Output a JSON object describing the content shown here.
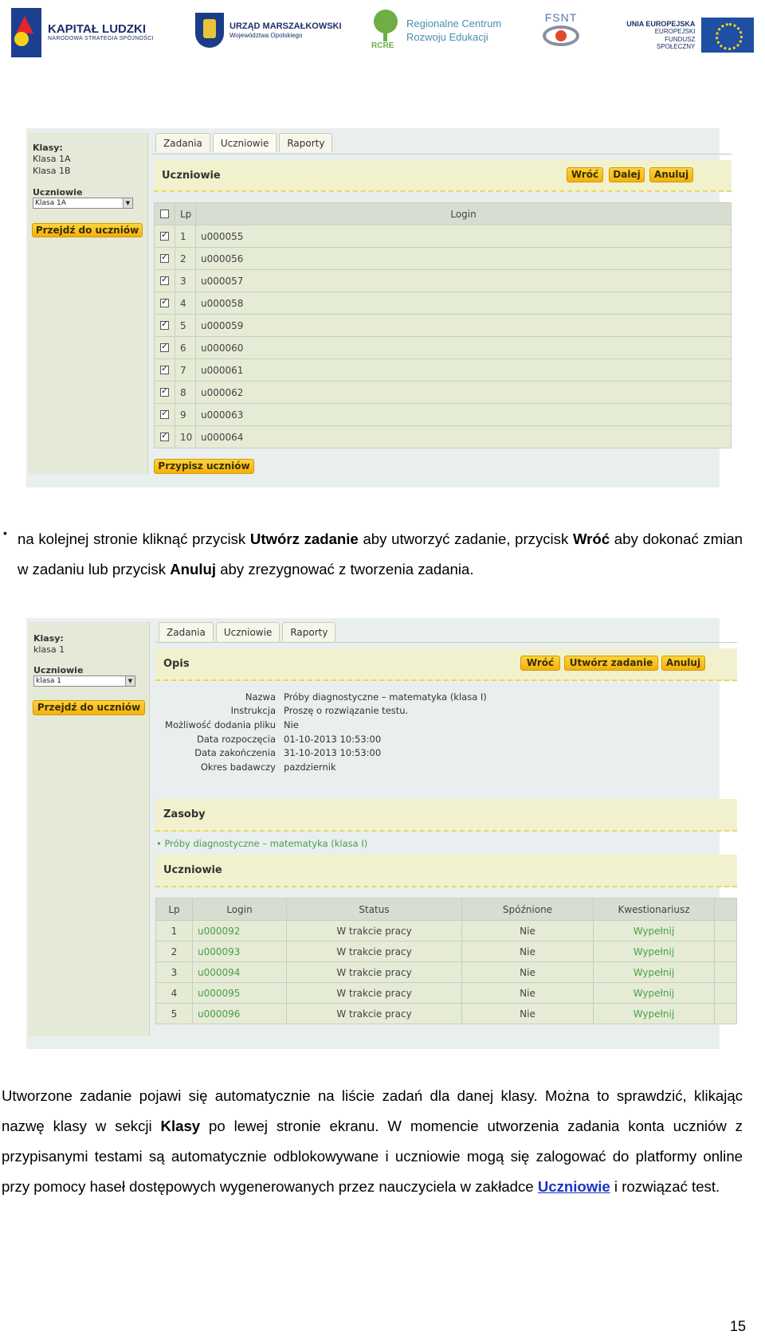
{
  "header": {
    "kapital_ludzki": {
      "title": "KAPITAŁ LUDZKI",
      "subtitle": "NARODOWA STRATEGIA SPÓJNOŚCI"
    },
    "urzad": {
      "title": "URZĄD MARSZAŁKOWSKI",
      "subtitle": "Województwa Opolskiego"
    },
    "rcre": {
      "abbr": "RCRE",
      "line1": "Regionalne Centrum",
      "line2": "Rozwoju Edukacji"
    },
    "fsnt": {
      "abbr": "FSNT"
    },
    "ue": {
      "line1": "UNIA EUROPEJSKA",
      "line2": "EUROPEJSKI",
      "line3": "FUNDUSZ SPOŁECZNY"
    }
  },
  "screen1": {
    "sidebar": {
      "classes_heading": "Klasy:",
      "classes": [
        "Klasa 1A",
        "Klasa 1B"
      ],
      "students_heading": "Uczniowie",
      "select_value": "Klasa 1A",
      "go_button": "Przejdź do uczniów"
    },
    "tabs": [
      "Zadania",
      "Uczniowie",
      "Raporty"
    ],
    "section_title": "Uczniowie",
    "buttons": {
      "back": "Wróć",
      "next": "Dalej",
      "cancel": "Anuluj"
    },
    "table": {
      "headers": [
        "Lp",
        "Login"
      ],
      "rows": [
        {
          "lp": "1",
          "login": "u000055"
        },
        {
          "lp": "2",
          "login": "u000056"
        },
        {
          "lp": "3",
          "login": "u000057"
        },
        {
          "lp": "4",
          "login": "u000058"
        },
        {
          "lp": "5",
          "login": "u000059"
        },
        {
          "lp": "6",
          "login": "u000060"
        },
        {
          "lp": "7",
          "login": "u000061"
        },
        {
          "lp": "8",
          "login": "u000062"
        },
        {
          "lp": "9",
          "login": "u000063"
        },
        {
          "lp": "10",
          "login": "u000064"
        }
      ]
    },
    "assign_button": "Przypisz uczniów"
  },
  "bullet_text": {
    "p1": "na kolejnej stronie kliknąć przycisk ",
    "b1": "Utwórz zadanie",
    "p2": " aby utworzyć zadanie, przycisk ",
    "b2": "Wróć",
    "p3": " aby dokonać zmian w zadaniu lub przycisk ",
    "b3": "Anuluj",
    "p4": " aby zrezygnować z tworzenia zadania."
  },
  "screen2": {
    "sidebar": {
      "classes_heading": "Klasy:",
      "classes": [
        "klasa 1"
      ],
      "students_heading": "Uczniowie",
      "select_value": "klasa 1",
      "go_button": "Przejdź do uczniów"
    },
    "tabs": [
      "Zadania",
      "Uczniowie",
      "Raporty"
    ],
    "opis_title": "Opis",
    "buttons": {
      "back": "Wróć",
      "create": "Utwórz zadanie",
      "cancel": "Anuluj"
    },
    "details": [
      {
        "key": "Nazwa",
        "value": "Próby diagnostyczne – matematyka (klasa I)"
      },
      {
        "key": "Instrukcja",
        "value": "Proszę o rozwiązanie testu."
      },
      {
        "key": "Możliwość dodania pliku",
        "value": "Nie"
      },
      {
        "key": "Data rozpoczęcia",
        "value": "01-10-2013 10:53:00"
      },
      {
        "key": "Data zakończenia",
        "value": "31-10-2013 10:53:00"
      },
      {
        "key": "Okres badawczy",
        "value": "pazdziernik"
      }
    ],
    "resources_title": "Zasoby",
    "resource_item": "Próby diagnostyczne – matematyka (klasa I)",
    "students_title": "Uczniowie",
    "table": {
      "headers": [
        "Lp",
        "Login",
        "Status",
        "Spóźnione",
        "Kwestionariusz"
      ],
      "rows": [
        {
          "lp": "1",
          "login": "u000092",
          "status": "W trakcie pracy",
          "late": "Nie",
          "form": "Wypełnij"
        },
        {
          "lp": "2",
          "login": "u000093",
          "status": "W trakcie pracy",
          "late": "Nie",
          "form": "Wypełnij"
        },
        {
          "lp": "3",
          "login": "u000094",
          "status": "W trakcie pracy",
          "late": "Nie",
          "form": "Wypełnij"
        },
        {
          "lp": "4",
          "login": "u000095",
          "status": "W trakcie pracy",
          "late": "Nie",
          "form": "Wypełnij"
        },
        {
          "lp": "5",
          "login": "u000096",
          "status": "W trakcie pracy",
          "late": "Nie",
          "form": "Wypełnij"
        }
      ]
    }
  },
  "closing": {
    "t1": "Utworzone zadanie pojawi się automatycznie na liście zadań dla danej klasy. Można to sprawdzić, klikając nazwę klasy w sekcji ",
    "b1": "Klasy",
    "t2": " po lewej stronie ekranu. W momencie utworzenia zadania konta uczniów z przypisanymi testami są automatycznie odblokowywane i uczniowie mogą się zalogować do platformy online przy pomocy haseł dostępowych wygenerowanych przez nauczyciela w zakładce ",
    "link": "Uczniowie",
    "t3": " i rozwiązać test."
  },
  "page_number": "15"
}
